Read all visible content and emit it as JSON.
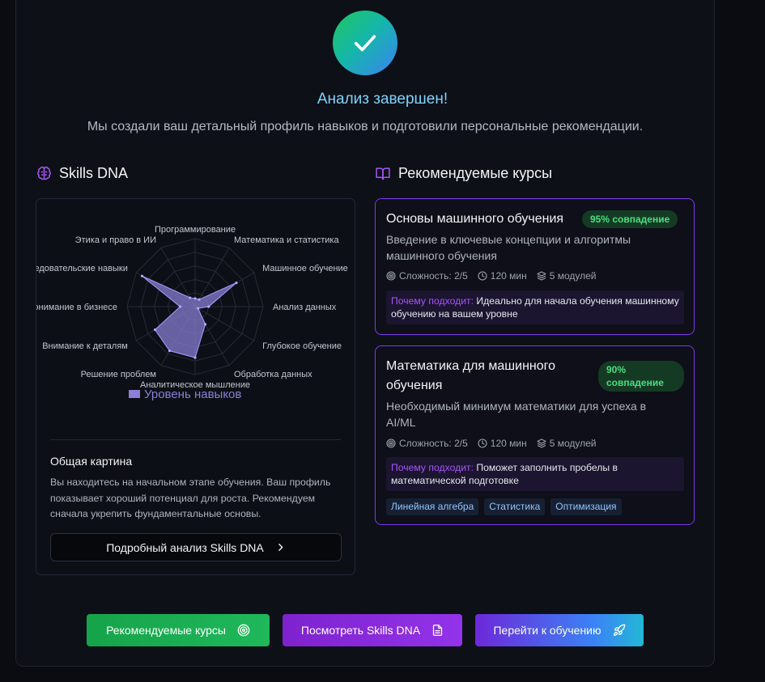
{
  "header": {
    "title": "Анализ завершен!",
    "subtitle": "Мы создали ваш детальный профиль навыков и подготовили персональные рекомендации."
  },
  "skills": {
    "heading": "Skills DNA",
    "radar_labels": [
      "Программирование",
      "Математика и статистика",
      "Машинное обучение",
      "Анализ данных",
      "Глубокое обучение",
      "Обработка данных",
      "Аналитическое мышление",
      "Решение проблем",
      "Внимание к деталям",
      "Понимание в бизнесе",
      "Исследовательские навыки",
      "Этика и право в ИИ"
    ],
    "radar_values": [
      0.12,
      0.12,
      0.7,
      0.2,
      0.05,
      0.3,
      0.75,
      0.75,
      0.68,
      0.22,
      0.9,
      0.15
    ],
    "legend": "Уровень навыков",
    "overview_title": "Общая картина",
    "overview_text": "Вы находитесь на начальном этапе обучения. Ваш профиль показывает хороший потенциал для роста. Рекомендуем сначала укрепить фундаментальные основы.",
    "detail_button": "Подробный анализ Skills DNA"
  },
  "courses": {
    "heading": "Рекомендуемые курсы",
    "items": [
      {
        "title": "Основы машинного обучения",
        "match": "95% совпадение",
        "description": "Введение в ключевые концепции и алгоритмы машинного обучения",
        "difficulty": "Сложность: 2/5",
        "duration": "120 мин",
        "modules": "5 модулей",
        "why_label": "Почему подходит:",
        "why_text": " Идеально для начала обучения машинному обучению на вашем уровне"
      },
      {
        "title": "Математика для машинного обучения",
        "match": "90% совпадение",
        "description": "Необходимый минимум математики для успеха в AI/ML",
        "difficulty": "Сложность: 2/5",
        "duration": "120 мин",
        "modules": "5 модулей",
        "why_label": "Почему подходит:",
        "why_text": " Поможет заполнить пробелы в математической подготовке",
        "tags": [
          "Линейная алгебра",
          "Статистика",
          "Оптимизация"
        ]
      }
    ]
  },
  "actions": {
    "recommended": "Рекомендуемые курсы",
    "view_dna": "Посмотреть Skills DNA",
    "start_learning": "Перейти к обучению"
  },
  "colors": {
    "accent_purple": "#7c3aed",
    "success_green": "#16a34a",
    "title_blue": "#7dd3fc",
    "radar_fill": "#8b7fd8"
  }
}
